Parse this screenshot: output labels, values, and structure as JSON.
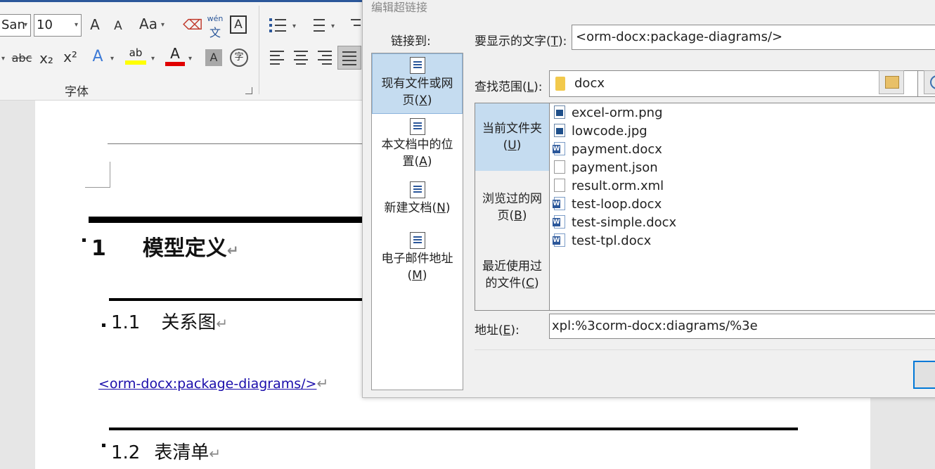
{
  "ribbon": {
    "font_name": "San",
    "font_size": "10",
    "group_label": "字体",
    "icons": {
      "grow_font": "A",
      "shrink_font": "A",
      "change_case": "Aa",
      "phonetic_top": "wén",
      "phonetic_bottom": "文",
      "char_border": "A",
      "strikethrough": "abc",
      "subscript": "x₂",
      "superscript": "x²",
      "text_effects": "A",
      "highlight": "ab",
      "font_color": "A",
      "char_shading": "A",
      "enclose_char": "字"
    }
  },
  "document": {
    "heading1_number": "1",
    "heading1_text": "模型定义",
    "heading2a_number": "1.1",
    "heading2a_text": "关系图",
    "hyperlink_text": "<orm-docx:package-diagrams/>",
    "heading2b_number": "1.2",
    "heading2b_text": "表清单",
    "para_mark": "↵"
  },
  "dialog": {
    "title": "编辑超链接",
    "link_to_label": "链接到:",
    "link_to_items": [
      {
        "label": "现有文件或网页(X)",
        "l1": "现有文件或网",
        "l2": "页(",
        "key": "X",
        "l3": ")"
      },
      {
        "label": "本文档中的位置(A)",
        "l1": "本文档中的位",
        "l2": "置(",
        "key": "A",
        "l3": ")"
      },
      {
        "label": "新建文档(N)",
        "l1": "",
        "l2": "新建文档(",
        "key": "N",
        "l3": ")"
      },
      {
        "label": "电子邮件地址(M)",
        "l1": "电子邮件地址",
        "l2": "(",
        "key": "M",
        "l3": ")"
      }
    ],
    "display_text_label_pre": "要显示的文字(",
    "display_text_label_key": "T",
    "display_text_label_post": "):",
    "display_text_value": "<orm-docx:package-diagrams/>",
    "look_in_label_pre": "查找范围(",
    "look_in_label_key": "L",
    "look_in_label_post": "):",
    "look_in_value": "docx",
    "places": [
      {
        "l1": "当前文件夹",
        "l2": "(",
        "key": "U",
        "l3": ")"
      },
      {
        "l1": "浏览过的网",
        "l2": "页(",
        "key": "B",
        "l3": ")"
      },
      {
        "l1": "最近使用过",
        "l2": "的文件(",
        "key": "C",
        "l3": ")"
      }
    ],
    "files": [
      {
        "name": "excel-orm.png",
        "icon": "image-file-icon"
      },
      {
        "name": "lowcode.jpg",
        "icon": "image-file-icon"
      },
      {
        "name": "payment.docx",
        "icon": "word-file-icon"
      },
      {
        "name": "payment.json",
        "icon": "blank-file-icon"
      },
      {
        "name": "result.orm.xml",
        "icon": "blank-file-icon"
      },
      {
        "name": "test-loop.docx",
        "icon": "word-file-icon"
      },
      {
        "name": "test-simple.docx",
        "icon": "word-file-icon"
      },
      {
        "name": "test-tpl.docx",
        "icon": "word-file-icon"
      }
    ],
    "address_label_pre": "地址(",
    "address_label_key": "E",
    "address_label_post": "):",
    "address_value": "xpl:%3corm-docx:diagrams/%3e"
  },
  "colors": {
    "accent": "#2b579a",
    "selection": "#c5dcf0",
    "hyperlink": "#1a0dab",
    "highlight_yellow": "#ffff00",
    "font_red": "#e00000"
  }
}
